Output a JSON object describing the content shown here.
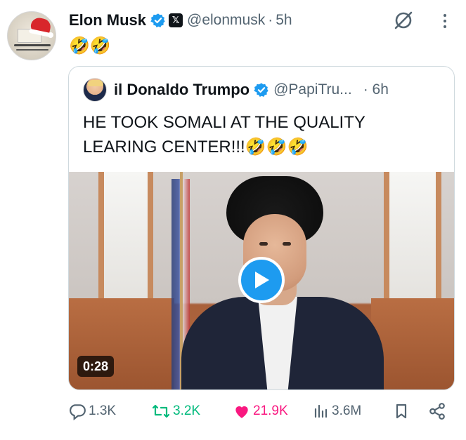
{
  "author": {
    "name": "Elon Musk",
    "handle": "@elonmusk",
    "separator": "·",
    "time": "5h"
  },
  "tweet": {
    "text": "🤣🤣"
  },
  "quote": {
    "name": "il Donaldo Trumpo",
    "handle": "@PapiTru...",
    "time": "· 6h",
    "text": "HE TOOK SOMALI AT THE QUALITY LEARING CENTER!!!🤣🤣🤣",
    "video": {
      "duration": "0:28"
    }
  },
  "actions": {
    "replies": "1.3K",
    "reposts": "3.2K",
    "likes": "21.9K",
    "views": "3.6M"
  },
  "colors": {
    "verified": "#1d9bf0",
    "repost": "#00ba7c",
    "like": "#f91880",
    "muted": "#536471"
  },
  "icons": {
    "verified": "verified-badge-icon",
    "affiliate": "x-logo-icon",
    "grok": "grok-icon",
    "more": "more-dots-icon",
    "reply": "reply-icon",
    "repost": "repost-icon",
    "like": "heart-icon",
    "views": "views-bar-icon",
    "bookmark": "bookmark-icon",
    "share": "share-icon",
    "play": "play-icon"
  }
}
